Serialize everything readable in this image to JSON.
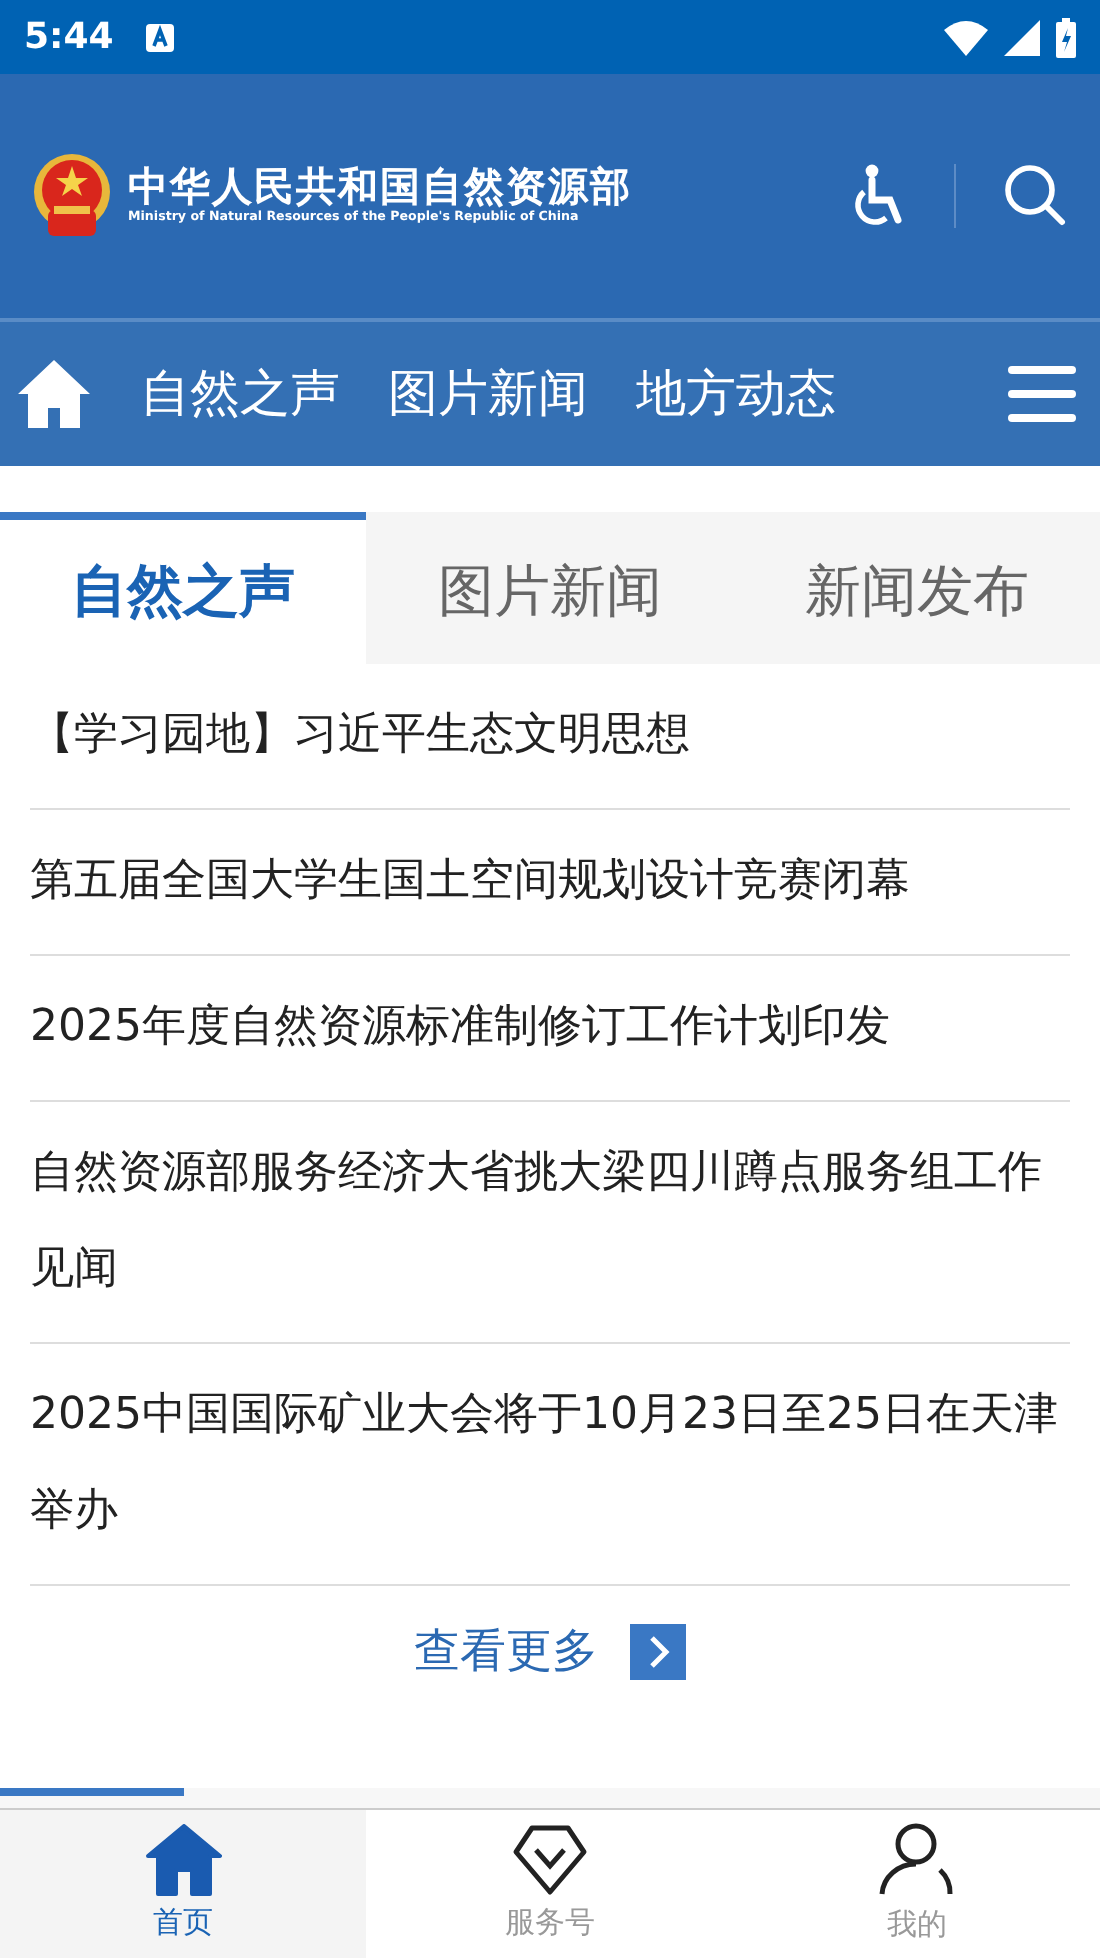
{
  "status_bar": {
    "time": "5:44"
  },
  "header": {
    "title": "中华人民共和国自然资源部",
    "subtitle": "Ministry of Natural Resources of the People's Republic of China"
  },
  "nav": {
    "items": [
      "自然之声",
      "图片新闻",
      "地方动态"
    ]
  },
  "tabs": [
    {
      "label": "自然之声",
      "selected": true
    },
    {
      "label": "图片新闻",
      "selected": false
    },
    {
      "label": "新闻发布",
      "selected": false
    }
  ],
  "news": [
    "【学习园地】习近平生态文明思想",
    "第五届全国大学生国土空间规划设计竞赛闭幕",
    "2025年度自然资源标准制修订工作计划印发",
    "自然资源部服务经济大省挑大梁四川蹲点服务组工作见闻",
    "2025中国国际矿业大会将于10月23日至25日在天津举办"
  ],
  "more": "查看更多",
  "bottom_nav": [
    {
      "label": "首页",
      "kind": "home",
      "selected": true
    },
    {
      "label": "服务号",
      "kind": "service",
      "selected": false
    },
    {
      "label": "我的",
      "kind": "user",
      "selected": false
    }
  ]
}
